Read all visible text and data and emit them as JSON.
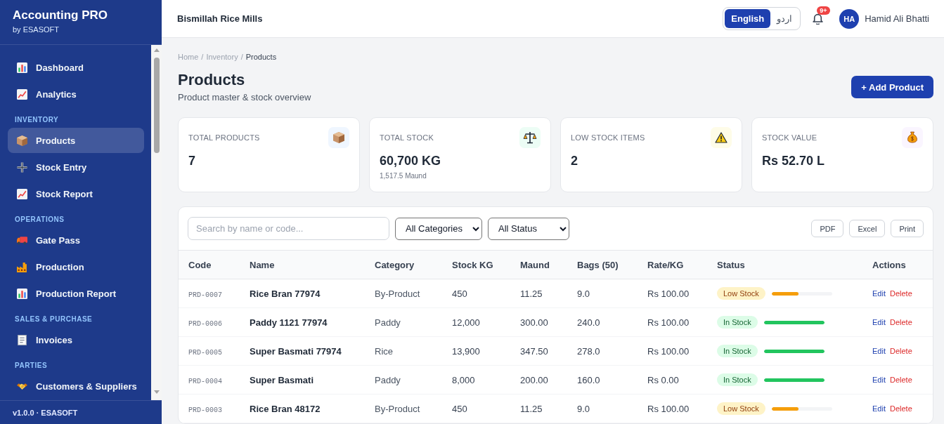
{
  "sidebar": {
    "title": "Accounting PRO",
    "subtitle": "by ESASOFT",
    "groups": [
      {
        "items": [
          {
            "label": "Dashboard",
            "selected": false
          },
          {
            "label": "Analytics",
            "selected": false
          }
        ]
      },
      {
        "heading": "INVENTORY",
        "items": [
          {
            "label": "Products",
            "selected": true
          },
          {
            "label": "Stock Entry",
            "selected": false
          },
          {
            "label": "Stock Report",
            "selected": false
          }
        ]
      },
      {
        "heading": "OPERATIONS",
        "items": [
          {
            "label": "Gate Pass",
            "selected": false
          },
          {
            "label": "Production",
            "selected": false
          },
          {
            "label": "Production Report",
            "selected": false
          }
        ]
      },
      {
        "heading": "SALES & PURCHASE",
        "items": [
          {
            "label": "Invoices",
            "selected": false
          }
        ]
      },
      {
        "heading": "PARTIES",
        "items": [
          {
            "label": "Customers & Suppliers",
            "selected": false
          }
        ]
      }
    ],
    "footer": "v1.0.0 · ESASOFT"
  },
  "header": {
    "company": "Bismillah Rice Mills",
    "languages": [
      {
        "label": "English",
        "selected": true
      },
      {
        "label": "اردو",
        "selected": false
      }
    ],
    "notifications": {
      "count": "9+"
    },
    "user": {
      "initials": "HA",
      "name": "Hamid Ali Bhatti"
    }
  },
  "page": {
    "breadcrumb": {
      "separator": "/",
      "items": [
        {
          "label": "Home",
          "current": false
        },
        {
          "label": "Inventory",
          "current": false
        },
        {
          "label": "Products",
          "current": true
        }
      ]
    },
    "title": "Products",
    "subtitle": "Product master & stock overview",
    "primary_action": "+ Add Product"
  },
  "stats": [
    {
      "label": "TOTAL PRODUCTS",
      "value": "7"
    },
    {
      "label": "TOTAL STOCK",
      "value": "60,700 KG",
      "note": "1,517.5 Maund"
    },
    {
      "label": "LOW STOCK ITEMS",
      "value": "2"
    },
    {
      "label": "STOCK VALUE",
      "value": "Rs 52.70 L"
    }
  ],
  "toolbar": {
    "search": {
      "placeholder": "Search by name or code..."
    },
    "filters": [
      {
        "value": "All Categories"
      },
      {
        "value": "All Status"
      }
    ],
    "exports": [
      "PDF",
      "Excel",
      "Print"
    ]
  },
  "table": {
    "columns": [
      "Code",
      "Name",
      "Category",
      "Stock KG",
      "Maund",
      "Bags (50)",
      "Rate/KG",
      "Status",
      "Actions"
    ],
    "rows": [
      {
        "code": "PRD-0007",
        "name": "Rice Bran 77974",
        "category": "By-Product",
        "stock_kg": "450",
        "maund": "11.25",
        "bags": "9.0",
        "rate": "Rs 100.00",
        "status": {
          "label": "Low Stock",
          "kind": "warning"
        },
        "level": 0.44,
        "actions": [
          {
            "label": "Edit",
            "kind": "edit"
          },
          {
            "label": "Delete",
            "kind": "delete"
          }
        ]
      },
      {
        "code": "PRD-0006",
        "name": "Paddy 1121 77974",
        "category": "Paddy",
        "stock_kg": "12,000",
        "maund": "300.00",
        "bags": "240.0",
        "rate": "Rs 100.00",
        "status": {
          "label": "In Stock",
          "kind": "success"
        },
        "level": 1,
        "actions": [
          {
            "label": "Edit",
            "kind": "edit"
          },
          {
            "label": "Delete",
            "kind": "delete"
          }
        ]
      },
      {
        "code": "PRD-0005",
        "name": "Super Basmati 77974",
        "category": "Rice",
        "stock_kg": "13,900",
        "maund": "347.50",
        "bags": "278.0",
        "rate": "Rs 100.00",
        "status": {
          "label": "In Stock",
          "kind": "success"
        },
        "level": 1,
        "actions": [
          {
            "label": "Edit",
            "kind": "edit"
          },
          {
            "label": "Delete",
            "kind": "delete"
          }
        ]
      },
      {
        "code": "PRD-0004",
        "name": "Super Basmati",
        "category": "Paddy",
        "stock_kg": "8,000",
        "maund": "200.00",
        "bags": "160.0",
        "rate": "Rs 0.00",
        "status": {
          "label": "In Stock",
          "kind": "success"
        },
        "level": 1,
        "actions": [
          {
            "label": "Edit",
            "kind": "edit"
          },
          {
            "label": "Delete",
            "kind": "delete"
          }
        ]
      },
      {
        "code": "PRD-0003",
        "name": "Rice Bran 48172",
        "category": "By-Product",
        "stock_kg": "450",
        "maund": "11.25",
        "bags": "9.0",
        "rate": "Rs 100.00",
        "status": {
          "label": "Low Stock",
          "kind": "warning"
        },
        "level": 0.44,
        "actions": [
          {
            "label": "Edit",
            "kind": "edit"
          },
          {
            "label": "Delete",
            "kind": "delete"
          }
        ]
      }
    ]
  }
}
